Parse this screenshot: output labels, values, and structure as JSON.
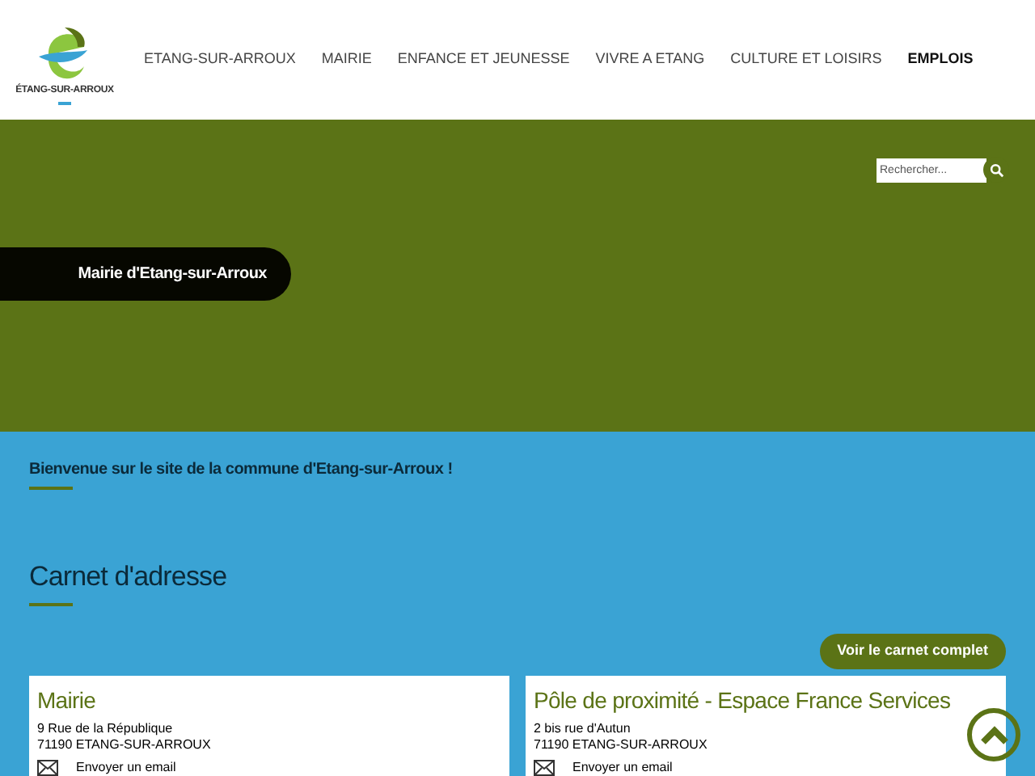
{
  "logo": {
    "text": "ÉTANG-SUR-ARROUX"
  },
  "nav": [
    {
      "label": "ETANG-SUR-ARROUX",
      "selected": false
    },
    {
      "label": "MAIRIE",
      "selected": false
    },
    {
      "label": "ENFANCE ET JEUNESSE",
      "selected": false
    },
    {
      "label": "VIVRE A ETANG",
      "selected": false
    },
    {
      "label": "CULTURE ET LOISIRS",
      "selected": false
    },
    {
      "label": "EMPLOIS",
      "selected": true
    }
  ],
  "search": {
    "placeholder": "Rechercher..."
  },
  "banner_title": "Mairie d'Etang-sur-Arroux",
  "welcome": "Bienvenue sur le site de la commune d'Etang-sur-Arroux !",
  "directory": {
    "title": "Carnet d'adresse",
    "button": "Voir le carnet complet",
    "cards": [
      {
        "name": "Mairie",
        "street": "9 Rue de la République",
        "city": "71190 ETANG-SUR-ARROUX",
        "email": "Envoyer un email"
      },
      {
        "name": "Pôle de proximité - Espace France Services",
        "street": "2 bis rue d'Autun",
        "city": "71190 ETANG-SUR-ARROUX",
        "email": "Envoyer un email"
      }
    ]
  }
}
